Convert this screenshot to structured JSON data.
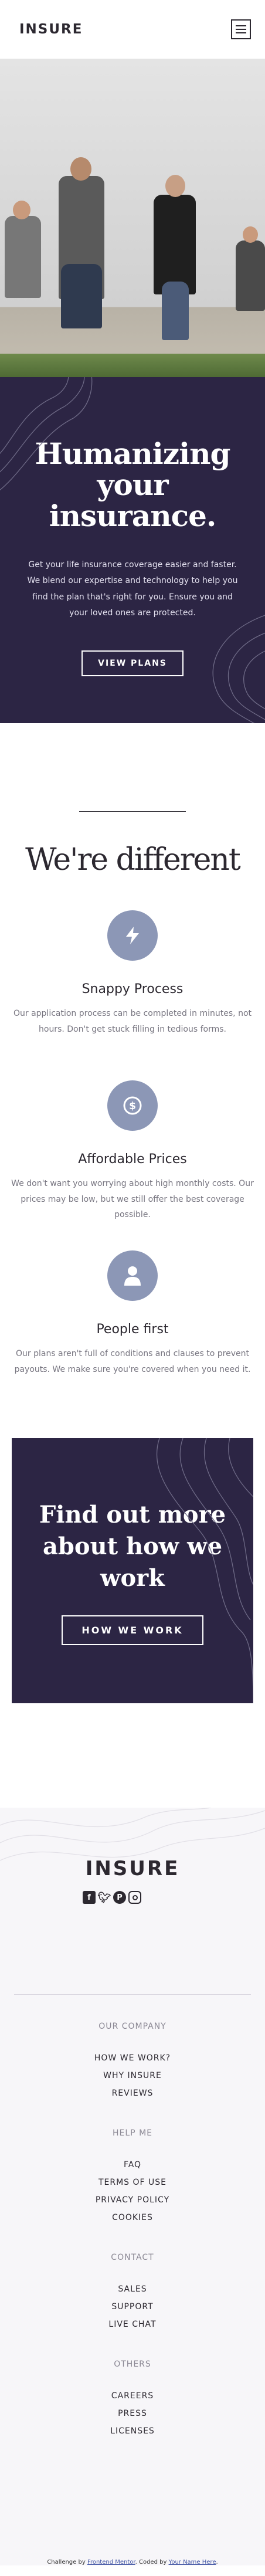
{
  "header": {
    "logo": "INSURE"
  },
  "hero": {
    "title": "Humanizing your insurance.",
    "description": "Get your life insurance coverage easier and faster. We blend our expertise and technology to help you find the plan that's right for you. Ensure you and your loved ones are protected.",
    "button": "VIEW PLANS"
  },
  "different": {
    "title": "We're different",
    "features": [
      {
        "title": "Snappy Process",
        "description": "Our application process can be completed in minutes, not hours. Don't get stuck filling in tedious forms.",
        "icon": "snappy-process-icon"
      },
      {
        "title": "Affordable Prices",
        "description": "We don't want you worrying about high monthly costs. Our prices may be low, but we still offer the best coverage possible.",
        "icon": "affordable-prices-icon"
      },
      {
        "title": "People first",
        "description": "Our plans aren't full of conditions and clauses to prevent payouts. We make sure you're covered when you need it.",
        "icon": "people-first-icon"
      }
    ]
  },
  "cta": {
    "title": "Find out more about how we work",
    "button": "HOW WE WORK"
  },
  "footer": {
    "logo": "INSURE",
    "groups": [
      {
        "title": "OUR COMPANY",
        "links": [
          "HOW WE WORK?",
          "WHY INSURE",
          "REVIEWS"
        ]
      },
      {
        "title": "HELP ME",
        "links": [
          "FAQ",
          "TERMS OF USE",
          "PRIVACY POLICY",
          "COOKIES"
        ]
      },
      {
        "title": "CONTACT",
        "links": [
          "SALES",
          "SUPPORT",
          "LIVE CHAT"
        ]
      },
      {
        "title": "OTHERS",
        "links": [
          "CAREERS",
          "PRESS",
          "LICENSES"
        ]
      }
    ],
    "attribution": {
      "prefix": "Challenge by ",
      "challenge_link": "Frontend Mentor",
      "middle": ". Coded by ",
      "author_link": "Your Name Here",
      "suffix": "."
    }
  },
  "colors": {
    "dark_violet": "#2c2544",
    "icon_circle": "#8c97b6",
    "page_bg": "#ffffff",
    "footer_bg": "#f7f6f9"
  }
}
